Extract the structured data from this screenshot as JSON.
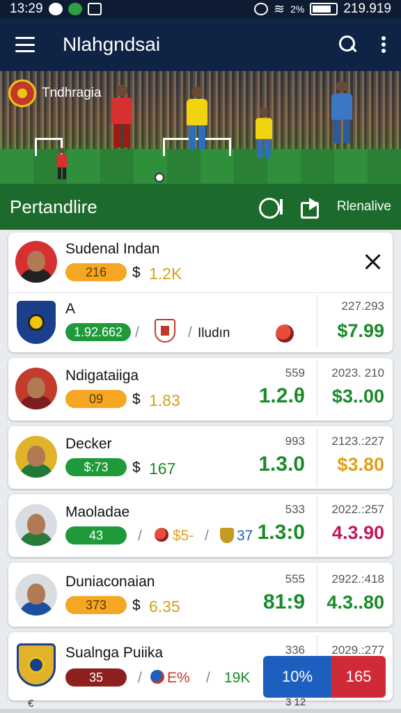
{
  "status_bar": {
    "time": "13:29",
    "right_text": "219.919",
    "signal_text": "2%"
  },
  "app_bar": {
    "title": "Nlahgndsai",
    "icons": [
      "menu-icon",
      "search-icon",
      "more-icon"
    ]
  },
  "hero": {
    "league_name": "Tndhragia"
  },
  "section": {
    "title": "Pertandlire",
    "action_label": "Rlenalive",
    "icons": [
      "chat-icon",
      "share-icon"
    ]
  },
  "colors": {
    "green": "#1f9a3a",
    "orange": "#f5a623",
    "red": "#cf2b36",
    "blue": "#1d5fbf",
    "navy": "#0f2444"
  },
  "rows": [
    {
      "name": "Sudenal Indan",
      "pill": "216",
      "currency": "$",
      "value": "1.2K"
    },
    {
      "name": "A",
      "pill": "1.92.662",
      "sep1": "/",
      "sep2": "/",
      "text": "Iludın",
      "right_top": "227.293",
      "right_big": "$7.99"
    },
    {
      "name": "Ndigataiiga",
      "pill": "09",
      "currency": "$",
      "value": "1.83",
      "mid_top": "559",
      "mid_big": "1.2.θ",
      "right_top": "2023. 210",
      "right_big": "$3..00"
    },
    {
      "name": "Decker",
      "pill": "$:73",
      "currency": "$",
      "value": "167",
      "mid_top": "993",
      "mid_big": "1.3.0",
      "right_top": "2123.:227",
      "right_big": "$3.80"
    },
    {
      "name": "Maoladae",
      "pill": "43",
      "sep1": "/",
      "value": "$5-",
      "sep2": "/",
      "value2": "37",
      "mid_top": "533",
      "mid_big": "1.3:0",
      "right_top": "2022.:257",
      "right_big": "4.3.90"
    },
    {
      "name": "Duniaconaian",
      "pill": "373",
      "currency": "$",
      "value": "6.35",
      "mid_top": "555",
      "mid_big": "81:9",
      "right_top": "2922.:418",
      "right_big": "4.3..80"
    },
    {
      "name": "Sualnga Puiika",
      "pill": "35",
      "sep1": "/",
      "value": "E%",
      "sep2": "/",
      "value2": "19K",
      "mid_top": "336",
      "right_top": "2029.:277"
    }
  ],
  "buttons": {
    "blue_label": "10%",
    "red_label": "165"
  },
  "footer": {
    "left_fragment": "€",
    "right_fragment": "3 12"
  }
}
